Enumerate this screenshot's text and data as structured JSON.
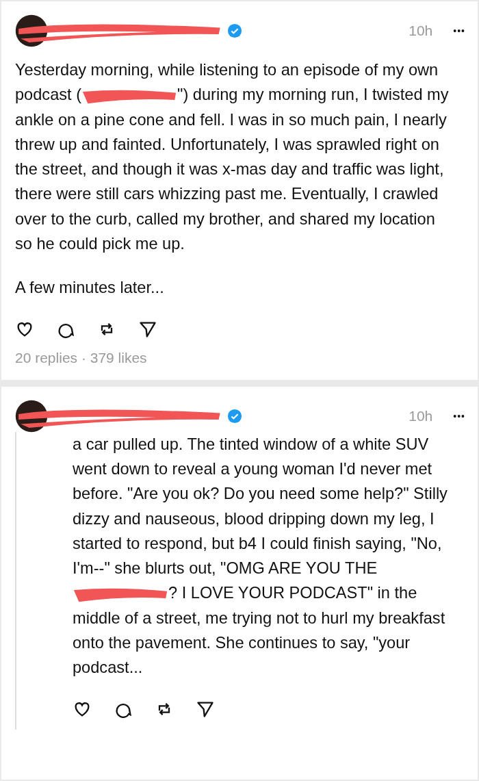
{
  "posts": [
    {
      "time": "10h",
      "more": "•••",
      "verified": true,
      "threaded": false,
      "paragraphs": [
        [
          {
            "kind": "text",
            "text": "Yesterday morning, while listening to an episode of my own podcast ("
          },
          {
            "kind": "redaction"
          },
          {
            "kind": "text",
            "text": "\") during my morning run, I twisted my ankle on a pine cone and fell. I was in so much pain, I nearly threw up and fainted. Unfortunately, I was sprawled right on the street, and though it was x-mas day and traffic was light, there were still cars whizzing past me. Eventually, I crawled over to the curb, called my brother, and shared my location so he could pick me up."
          }
        ],
        [
          {
            "kind": "text",
            "text": "A few minutes later..."
          }
        ]
      ],
      "stats": "20 replies · 379 likes"
    },
    {
      "time": "10h",
      "more": "•••",
      "verified": true,
      "threaded": true,
      "paragraphs": [
        [
          {
            "kind": "text",
            "text": "a car pulled up. The tinted window of a white SUV went down to reveal a young woman I'd never met before. \"Are you ok? Do you need some help?\" Stilly dizzy and nauseous, blood dripping down my leg, I started to respond, but b4 I could finish saying, \"No, I'm--\" she blurts out, \"OMG ARE YOU THE "
          },
          {
            "kind": "redaction"
          },
          {
            "kind": "text",
            "text": "? I LOVE YOUR PODCAST\" in the middle of a street, me trying not to hurl my breakfast onto the pavement. She continues to say, \"your podcast..."
          }
        ]
      ]
    }
  ]
}
